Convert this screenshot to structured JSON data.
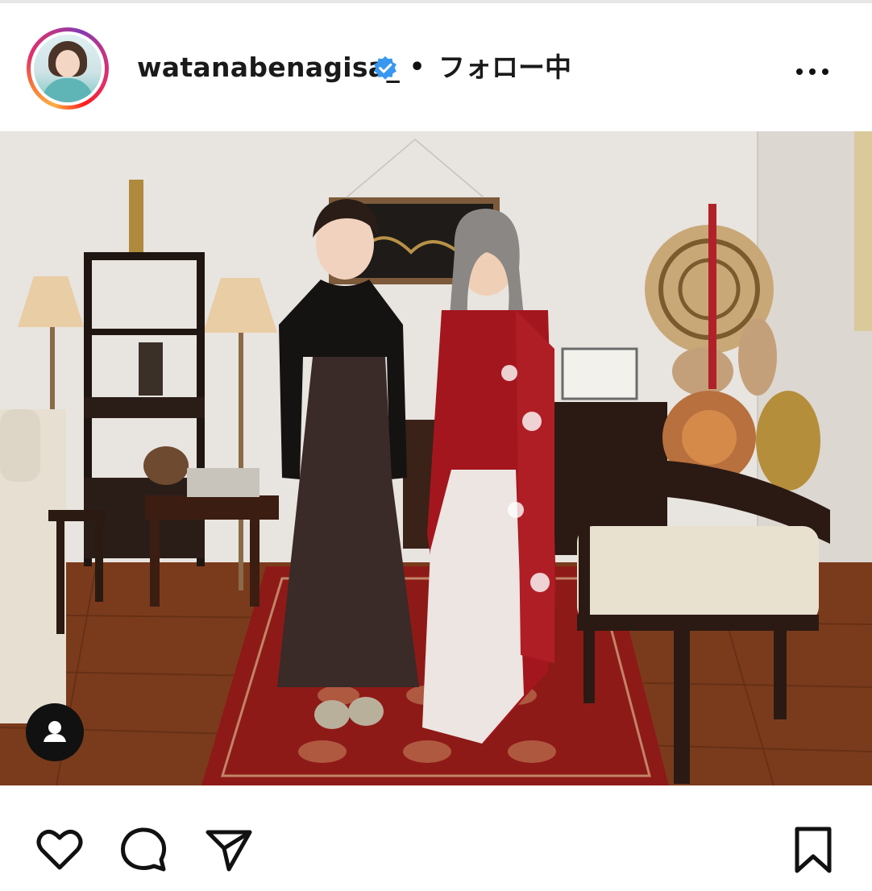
{
  "post": {
    "username": "watanabenagisa_",
    "separator": "•",
    "follow_status": "フォロー中",
    "verified": true,
    "more_icon": "more-horizontal-icon",
    "photo_tag_icon": "user-tag-icon"
  },
  "actions": {
    "like_icon": "heart-icon",
    "comment_icon": "comment-icon",
    "share_icon": "send-icon",
    "save_icon": "bookmark-icon"
  },
  "colors": {
    "verified_badge": "#3897f0",
    "icon": "#111111",
    "saree_red": "#a4161e",
    "rug_red": "#8e1a17",
    "floor_wood": "#7a3b1c"
  }
}
